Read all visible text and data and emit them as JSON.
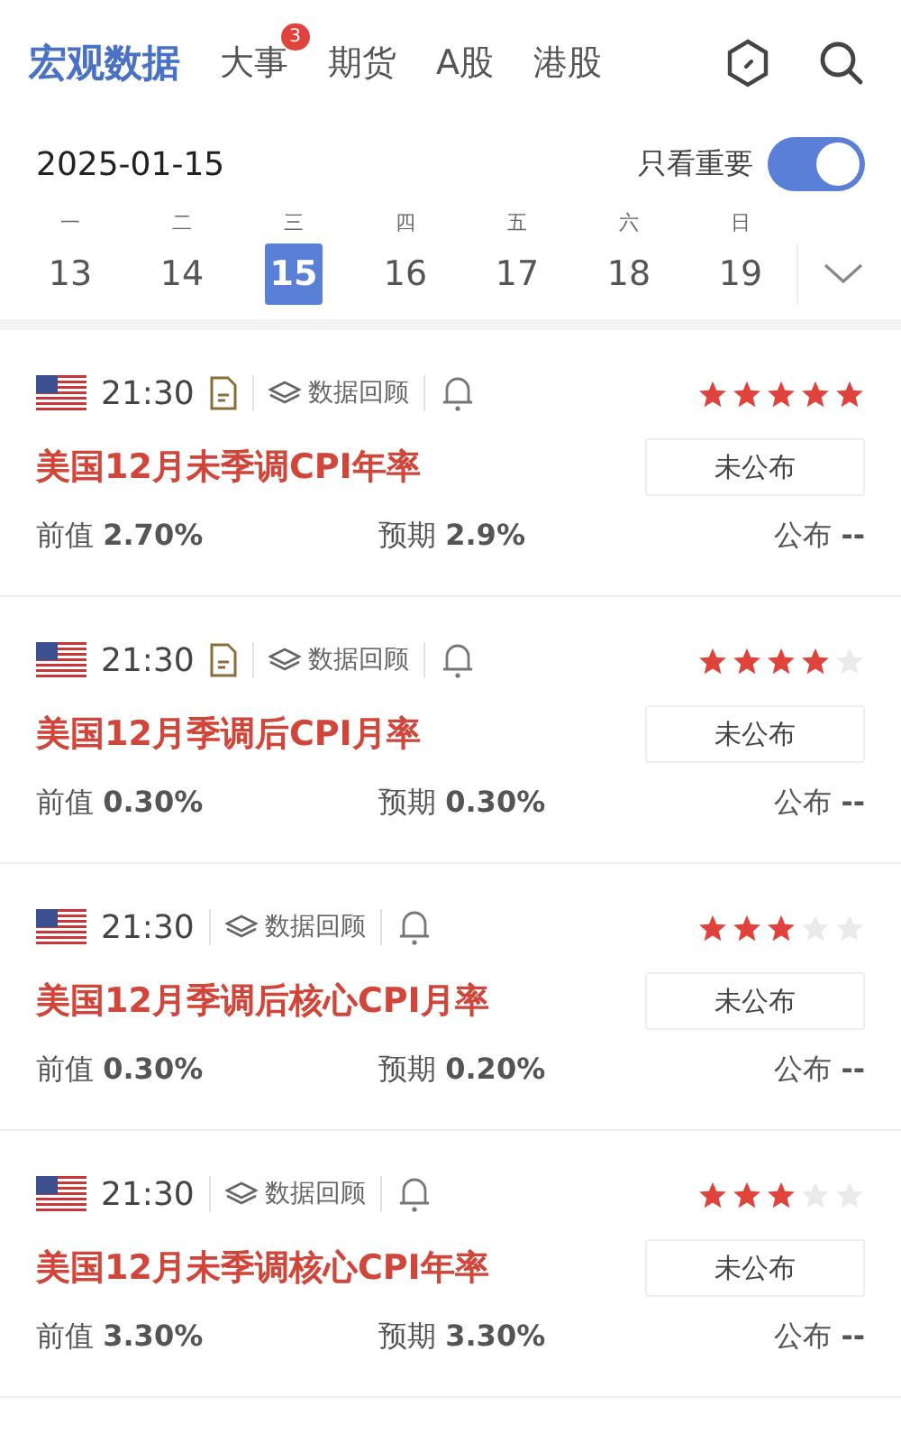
{
  "tabs": [
    {
      "label": "宏观数据",
      "selected": true
    },
    {
      "label": "大事",
      "selected": false,
      "badge": "3"
    },
    {
      "label": "期货",
      "selected": false
    },
    {
      "label": "A股",
      "selected": false
    },
    {
      "label": "港股",
      "selected": false
    }
  ],
  "date": "2025-01-15",
  "important_only": {
    "label": "只看重要",
    "on": true
  },
  "week": [
    {
      "weekday": "一",
      "day": "13",
      "selected": false
    },
    {
      "weekday": "二",
      "day": "14",
      "selected": false
    },
    {
      "weekday": "三",
      "day": "15",
      "selected": true
    },
    {
      "weekday": "四",
      "day": "16",
      "selected": false
    },
    {
      "weekday": "五",
      "day": "17",
      "selected": false
    },
    {
      "weekday": "六",
      "day": "18",
      "selected": false
    },
    {
      "weekday": "日",
      "day": "19",
      "selected": false
    }
  ],
  "events": [
    {
      "time": "21:30",
      "has_doc": true,
      "review": "数据回顾",
      "stars": 5,
      "title": "美国12月未季调CPI年率",
      "status": "未公布",
      "prev_label": "前值",
      "prev": "2.70%",
      "forecast_label": "预期",
      "forecast": "2.9%",
      "actual_label": "公布",
      "actual": "--"
    },
    {
      "time": "21:30",
      "has_doc": true,
      "review": "数据回顾",
      "stars": 4,
      "title": "美国12月季调后CPI月率",
      "status": "未公布",
      "prev_label": "前值",
      "prev": "0.30%",
      "forecast_label": "预期",
      "forecast": "0.30%",
      "actual_label": "公布",
      "actual": "--"
    },
    {
      "time": "21:30",
      "has_doc": false,
      "review": "数据回顾",
      "stars": 3,
      "title": "美国12月季调后核心CPI月率",
      "status": "未公布",
      "prev_label": "前值",
      "prev": "0.30%",
      "forecast_label": "预期",
      "forecast": "0.20%",
      "actual_label": "公布",
      "actual": "--"
    },
    {
      "time": "21:30",
      "has_doc": false,
      "review": "数据回顾",
      "stars": 3,
      "title": "美国12月未季调核心CPI年率",
      "status": "未公布",
      "prev_label": "前值",
      "prev": "3.30%",
      "forecast_label": "预期",
      "forecast": "3.30%",
      "actual_label": "公布",
      "actual": "--"
    }
  ]
}
